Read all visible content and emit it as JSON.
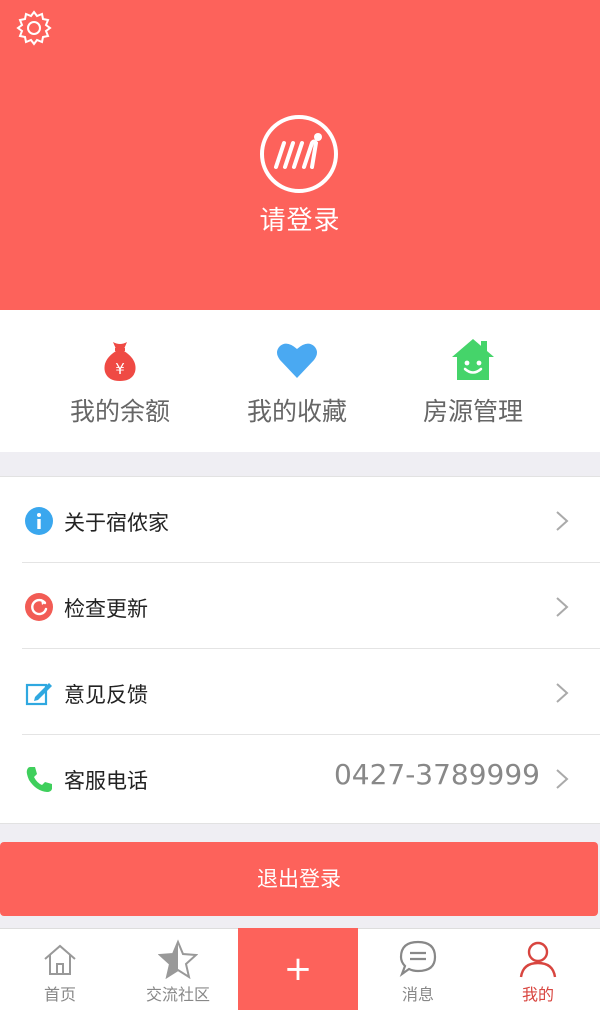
{
  "header": {
    "login_text": "请登录",
    "settings_icon": "gear-icon",
    "logo_icon": "app-logo-icon",
    "color": "#fd625b"
  },
  "quick_actions": [
    {
      "label": "我的余额",
      "icon": "money-bag-icon"
    },
    {
      "label": "我的收藏",
      "icon": "heart-icon"
    },
    {
      "label": "房源管理",
      "icon": "house-icon"
    }
  ],
  "menu": [
    {
      "label": "关于宿侬家",
      "icon": "info-icon",
      "value": ""
    },
    {
      "label": "检查更新",
      "icon": "refresh-icon",
      "value": ""
    },
    {
      "label": "意见反馈",
      "icon": "edit-icon",
      "value": ""
    },
    {
      "label": "客服电话",
      "icon": "phone-icon",
      "value": "0427-3789999"
    }
  ],
  "logout_label": "退出登录",
  "tabbar": {
    "items": [
      {
        "label": "首页",
        "icon": "home-icon",
        "active": false
      },
      {
        "label": "交流社区",
        "icon": "star-icon",
        "active": false
      },
      {
        "label": "消息",
        "icon": "chat-icon",
        "active": false
      },
      {
        "label": "我的",
        "icon": "user-icon",
        "active": true
      }
    ],
    "add_label": "+"
  }
}
